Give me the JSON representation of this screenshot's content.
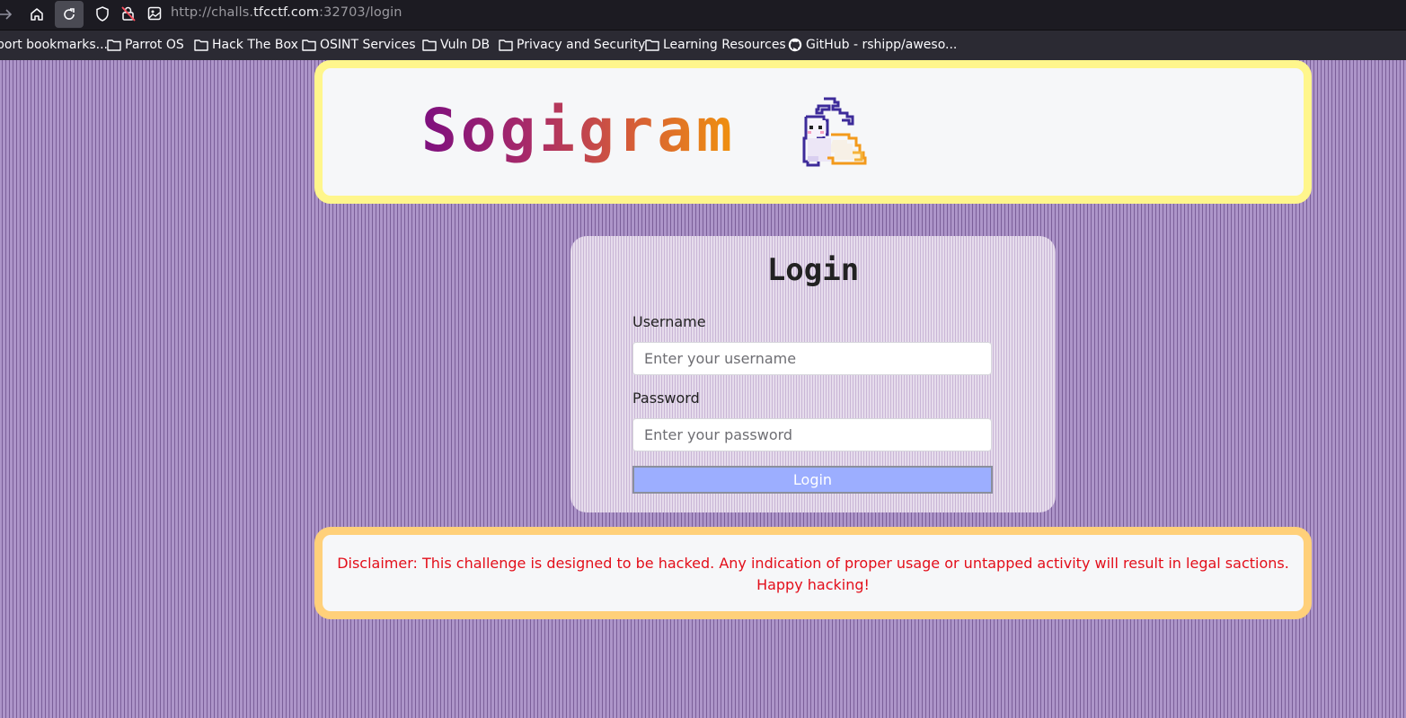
{
  "browser": {
    "url_prefix": "http://challs.",
    "url_host": "tfcctf.com",
    "url_suffix": ":32703/login"
  },
  "bookmarks": [
    {
      "label": "port bookmarks..."
    },
    {
      "label": "Parrot OS"
    },
    {
      "label": "Hack The Box"
    },
    {
      "label": "OSINT Services"
    },
    {
      "label": "Vuln DB"
    },
    {
      "label": "Privacy and Security"
    },
    {
      "label": "Learning Resources"
    },
    {
      "label": "GitHub - rshipp/aweso..."
    }
  ],
  "header": {
    "logo_text": "Sogigram"
  },
  "login": {
    "title": "Login",
    "username_label": "Username",
    "username_placeholder": "Enter your username",
    "password_label": "Password",
    "password_placeholder": "Enter your password",
    "button_label": "Login"
  },
  "disclaimer": {
    "text": "Disclaimer: This challenge is designed to be hacked. Any indication of proper usage or untapped activity will result in legal sactions. Happy hacking!"
  },
  "colors": {
    "accent_button": "#9caeff",
    "header_border": "#fff68c",
    "disclaimer_border": "#ffd07a",
    "disclaimer_text": "#e30e1a"
  }
}
